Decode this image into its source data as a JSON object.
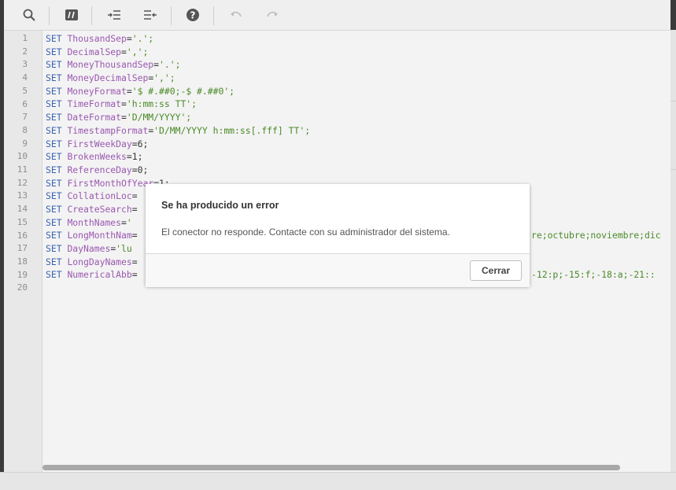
{
  "toolbar": {
    "buttons": [
      "search-icon",
      "comment-icon",
      "indent-icon",
      "outdent-icon",
      "help-icon",
      "undo-icon",
      "redo-icon"
    ]
  },
  "editor": {
    "line_numbers": [
      "1",
      "2",
      "3",
      "4",
      "5",
      "6",
      "7",
      "8",
      "9",
      "10",
      "11",
      "12",
      "13",
      "14",
      "15",
      "16",
      "17",
      "18",
      "19",
      "20"
    ],
    "lines": [
      {
        "kw": "SET",
        "var": "ThousandSep",
        "val": "'.';"
      },
      {
        "kw": "SET",
        "var": "DecimalSep",
        "val": "',';"
      },
      {
        "kw": "SET",
        "var": "MoneyThousandSep",
        "val": "'.';"
      },
      {
        "kw": "SET",
        "var": "MoneyDecimalSep",
        "val": "',';"
      },
      {
        "kw": "SET",
        "var": "MoneyFormat",
        "val": "'$ #.##0;-$ #.##0';"
      },
      {
        "kw": "SET",
        "var": "TimeFormat",
        "val": "'h:mm:ss TT';"
      },
      {
        "kw": "SET",
        "var": "DateFormat",
        "val": "'D/MM/YYYY';"
      },
      {
        "kw": "SET",
        "var": "TimestampFormat",
        "val": "'D/MM/YYYY h:mm:ss[.fff] TT';"
      },
      {
        "kw": "SET",
        "var": "FirstWeekDay",
        "val": "6;"
      },
      {
        "kw": "SET",
        "var": "BrokenWeeks",
        "val": "1;"
      },
      {
        "kw": "SET",
        "var": "ReferenceDay",
        "val": "0;"
      },
      {
        "kw": "SET",
        "var": "FirstMonthOfYear",
        "val": "1;"
      },
      {
        "kw": "SET",
        "var": "CollationLoc",
        "val": ""
      },
      {
        "kw": "SET",
        "var": "CreateSearch",
        "val": ""
      },
      {
        "kw": "SET",
        "var": "MonthNames",
        "val": "'"
      },
      {
        "kw": "SET",
        "var": "LongMonthNam",
        "val": "",
        "tail": "re;octubre;noviembre;dic"
      },
      {
        "kw": "SET",
        "var": "DayNames",
        "val": "'lu"
      },
      {
        "kw": "SET",
        "var": "LongDayNames",
        "val": ""
      },
      {
        "kw": "SET",
        "var": "NumericalAbb",
        "val": "",
        "tail": "-12:p;-15:f;-18:a;-21::"
      },
      {
        "kw": "",
        "var": "",
        "val": ""
      }
    ]
  },
  "dialog": {
    "title": "Se ha producido un error",
    "message": "El conector no responde. Contacte con su administrador del sistema.",
    "close_label": "Cerrar"
  }
}
